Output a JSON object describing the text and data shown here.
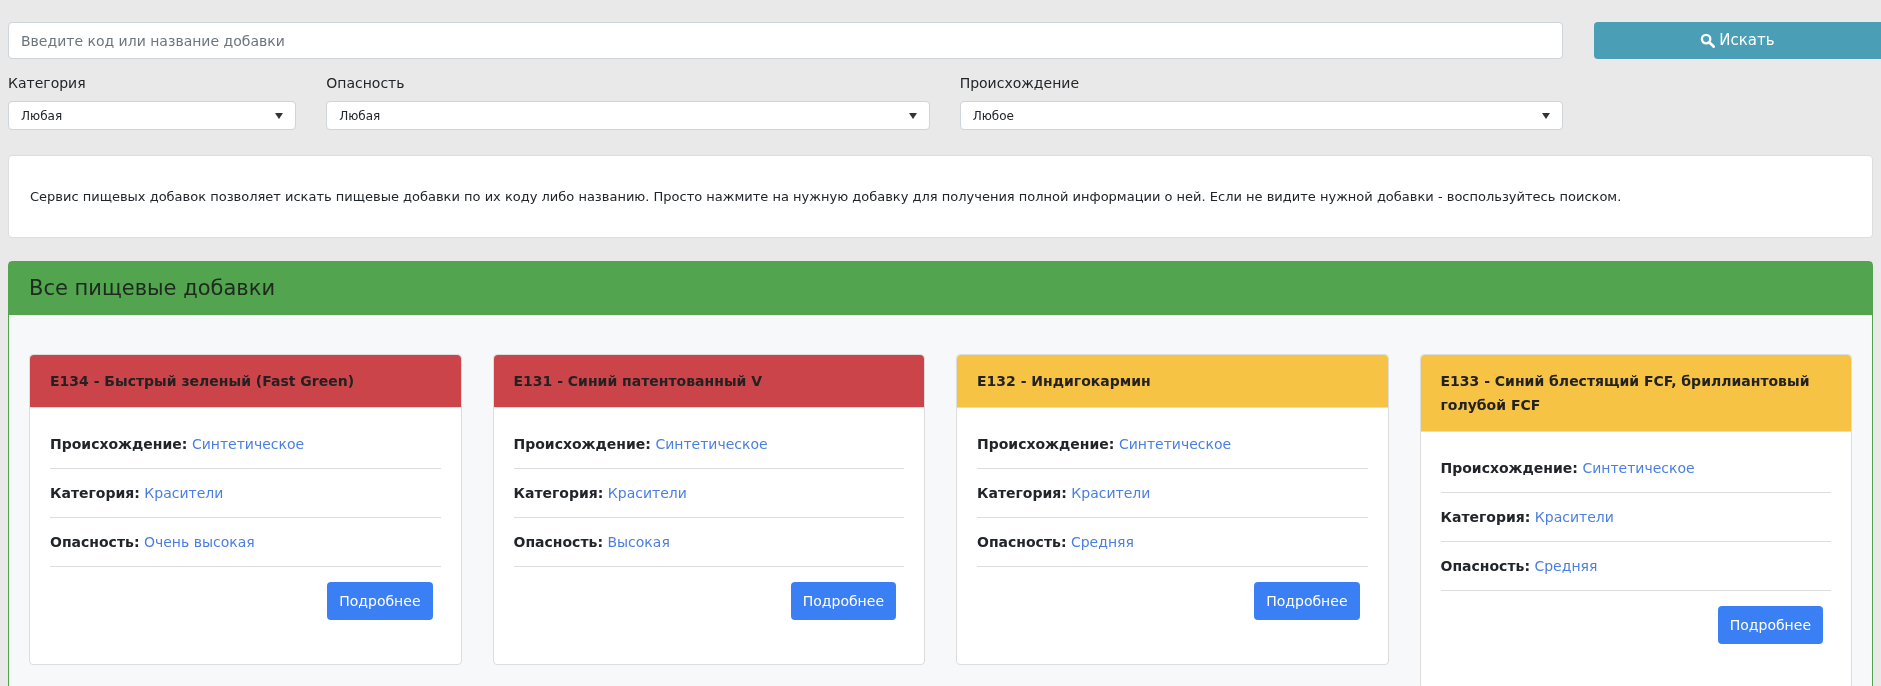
{
  "search": {
    "placeholder": "Введите код или название добавки",
    "button": "Искать"
  },
  "filters": [
    {
      "label": "Категория",
      "value": "Любая"
    },
    {
      "label": "Опасность",
      "value": "Любая"
    },
    {
      "label": "Происхождение",
      "value": "Любое"
    }
  ],
  "info": "Сервис пищевых добавок позволяет искать пищевые добавки по их коду либо названию. Просто нажмите на нужную добавку для получения полной информации о ней. Если не видите нужной добавки - воспользуйтесь поиском.",
  "panel": {
    "title": "Все пищевые добавки",
    "cards": [
      {
        "title": "E134 - Быстрый зеленый (Fast Green)",
        "color": "#cb444a",
        "fields": [
          {
            "label": "Происхождение:",
            "value": "Синтетическое"
          },
          {
            "label": "Категория:",
            "value": "Красители"
          },
          {
            "label": "Опасность:",
            "value": "Очень высокая"
          }
        ],
        "button": "Подробнее"
      },
      {
        "title": "E131 - Синий патентованный V",
        "color": "#cb444a",
        "fields": [
          {
            "label": "Происхождение:",
            "value": "Синтетическое"
          },
          {
            "label": "Категория:",
            "value": "Красители"
          },
          {
            "label": "Опасность:",
            "value": "Высокая"
          }
        ],
        "button": "Подробнее"
      },
      {
        "title": "E132 - Индигокармин",
        "color": "#f6c344",
        "fields": [
          {
            "label": "Происхождение:",
            "value": "Синтетическое"
          },
          {
            "label": "Категория:",
            "value": "Красители"
          },
          {
            "label": "Опасность:",
            "value": "Средняя"
          }
        ],
        "button": "Подробнее"
      },
      {
        "title": "E133 - Синий блестящий FCF, бриллиантовый голубой FCF",
        "color": "#f6c344",
        "fields": [
          {
            "label": "Происхождение:",
            "value": "Синтетическое"
          },
          {
            "label": "Категория:",
            "value": "Красители"
          },
          {
            "label": "Опасность:",
            "value": "Средняя"
          }
        ],
        "button": "Подробнее"
      }
    ]
  }
}
